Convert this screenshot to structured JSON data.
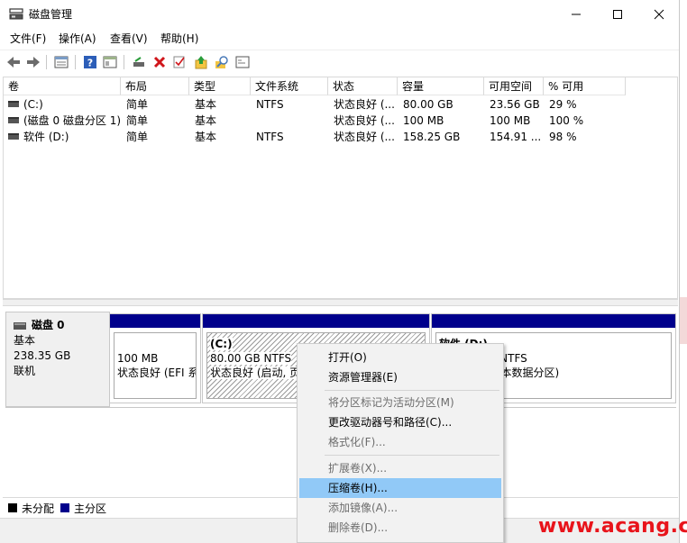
{
  "window": {
    "title": "磁盘管理",
    "controls": {
      "minimize": "—",
      "maximize": "☐",
      "close": "✕"
    }
  },
  "menu": [
    "文件(F)",
    "操作(A)",
    "查看(V)",
    "帮助(H)"
  ],
  "toolbar": {
    "icons": [
      "back-arrow-icon",
      "forward-arrow-icon",
      "properties-icon",
      "help-icon",
      "view-icon",
      "connect-disk-icon",
      "delete-icon",
      "check-icon",
      "upload-icon",
      "search-icon",
      "console-icon"
    ]
  },
  "columns": [
    "卷",
    "布局",
    "类型",
    "文件系统",
    "状态",
    "容量",
    "可用空间",
    "% 可用"
  ],
  "volumes": [
    {
      "name": "(C:)",
      "layout": "简单",
      "type": "基本",
      "fs": "NTFS",
      "status": "状态良好 (...",
      "capacity": "80.00 GB",
      "free": "23.56 GB",
      "pct": "29 %"
    },
    {
      "name": "(磁盘 0 磁盘分区 1)",
      "layout": "简单",
      "type": "基本",
      "fs": "",
      "status": "状态良好 (...",
      "capacity": "100 MB",
      "free": "100 MB",
      "pct": "100 %"
    },
    {
      "name": "软件 (D:)",
      "layout": "简单",
      "type": "基本",
      "fs": "NTFS",
      "status": "状态良好 (...",
      "capacity": "158.25 GB",
      "free": "154.91 ...",
      "pct": "98 %"
    }
  ],
  "disk": {
    "name": "磁盘 0",
    "type": "基本",
    "size": "238.35 GB",
    "state": "联机"
  },
  "partitions": [
    {
      "title": "",
      "size_line": "100 MB",
      "status_line": "状态良好 (EFI 系"
    },
    {
      "title": "(C:)",
      "size_line": "80.00 GB NTFS",
      "status_line": "状态良好 (启动, 页"
    },
    {
      "title": "软件 (D:)",
      "size_line": "158.25 GB NTFS",
      "status_line": "状态良好 (基本数据分区)"
    }
  ],
  "legend": {
    "unallocated": "未分配",
    "primary": "主分区"
  },
  "colors": {
    "primary_partition": "#00008c",
    "unallocated": "#000000",
    "highlight": "#91c9f7"
  },
  "context_menu": {
    "items": [
      {
        "label": "打开(O)",
        "enabled": true
      },
      {
        "label": "资源管理器(E)",
        "enabled": true
      },
      {
        "label": "将分区标记为活动分区(M)",
        "enabled": false
      },
      {
        "label": "更改驱动器号和路径(C)...",
        "enabled": true
      },
      {
        "label": "格式化(F)...",
        "enabled": false
      },
      {
        "label": "扩展卷(X)...",
        "enabled": false
      },
      {
        "label": "压缩卷(H)...",
        "enabled": true,
        "highlighted": true
      },
      {
        "label": "添加镜像(A)...",
        "enabled": false
      },
      {
        "label": "删除卷(D)...",
        "enabled": false
      }
    ]
  },
  "watermark": "www.acang.cn"
}
